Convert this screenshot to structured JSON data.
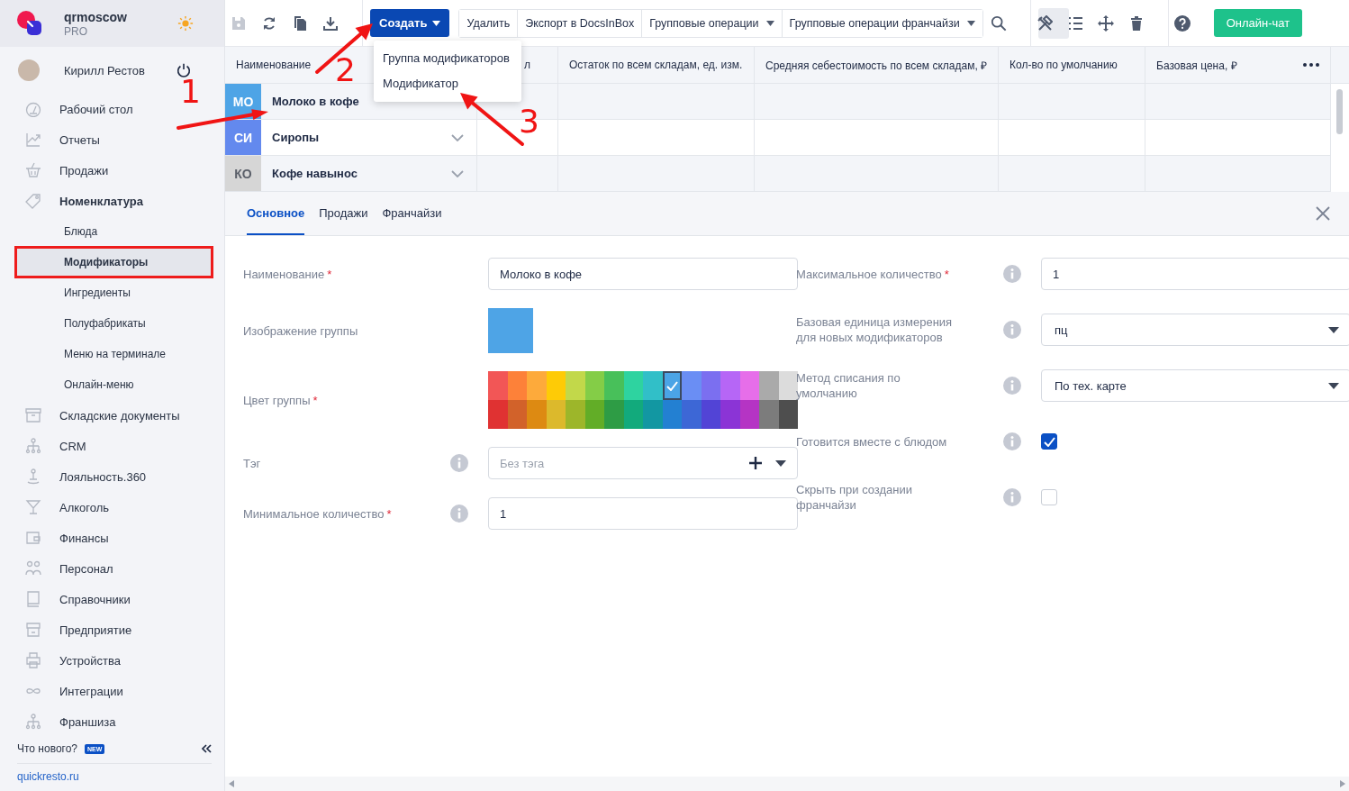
{
  "sidebar": {
    "account": {
      "name": "qrmoscow",
      "plan": "PRO"
    },
    "user": {
      "name": "Кирилл Рестов"
    },
    "nav": [
      {
        "label": "Рабочий стол",
        "expanded": false
      },
      {
        "label": "Отчеты",
        "expanded": false
      },
      {
        "label": "Продажи",
        "expanded": false
      },
      {
        "label": "Номенклатура",
        "expanded": true,
        "children": [
          {
            "label": "Блюда",
            "selected": false,
            "highlighted": false
          },
          {
            "label": "Модификаторы",
            "selected": true,
            "highlighted": true
          },
          {
            "label": "Ингредиенты",
            "selected": false,
            "highlighted": false
          },
          {
            "label": "Полуфабрикаты",
            "selected": false,
            "highlighted": false
          },
          {
            "label": "Меню на терминале",
            "selected": false,
            "highlighted": false
          },
          {
            "label": "Онлайн-меню",
            "selected": false,
            "highlighted": false
          }
        ]
      },
      {
        "label": "Складские документы",
        "expanded": false
      },
      {
        "label": "CRM",
        "expanded": false
      },
      {
        "label": "Лояльность.360",
        "expanded": false
      },
      {
        "label": "Алкоголь",
        "expanded": false
      },
      {
        "label": "Финансы",
        "expanded": false
      },
      {
        "label": "Персонал",
        "expanded": false
      },
      {
        "label": "Справочники",
        "expanded": false
      },
      {
        "label": "Предприятие",
        "expanded": false
      },
      {
        "label": "Устройства",
        "expanded": false
      },
      {
        "label": "Интеграции",
        "expanded": false
      },
      {
        "label": "Франшиза",
        "expanded": false
      }
    ],
    "whats_new": {
      "label": "Что нового?",
      "badge": "NEW"
    },
    "footer_link": "quickresto.ru"
  },
  "toolbar": {
    "create": {
      "label": "Создать",
      "open": true
    },
    "create_menu": [
      "Группа модификаторов",
      "Модификатор"
    ],
    "actions": [
      {
        "label": "Удалить",
        "dropdown": false
      },
      {
        "label": "Экспорт в DocsInBox",
        "dropdown": false
      },
      {
        "label": "Групповые операции",
        "dropdown": true
      },
      {
        "label": "Групповые операции франчайзи",
        "dropdown": true
      }
    ],
    "view_tools": [
      {
        "selected": true
      },
      {
        "selected": false
      },
      {
        "selected": false
      },
      {
        "selected": false
      }
    ],
    "chat_button": "Онлайн-чат"
  },
  "table": {
    "columns": [
      "Наименование",
      "л",
      "Остаток по всем складам, ед. изм.",
      "Средняя себестоимость по всем складам, ₽",
      "Кол-во по умолчанию",
      "Базовая цена, ₽"
    ],
    "rows": [
      {
        "tag": "МО",
        "color": "#4ea4e6",
        "name": "Молоко в кофе",
        "expandable": false
      },
      {
        "tag": "СИ",
        "color": "#6389ee",
        "name": "Сиропы",
        "expandable": true
      },
      {
        "tag": "КО",
        "color": "#d6d6d6",
        "name": "Кофе навынос",
        "expandable": true
      }
    ]
  },
  "detail": {
    "tabs": [
      {
        "label": "Основное",
        "selected": true
      },
      {
        "label": "Продажи",
        "selected": false
      },
      {
        "label": "Франчайзи",
        "selected": false
      }
    ],
    "left": [
      {
        "kind": "text",
        "label": "Наименование",
        "required_mark": "*",
        "info": false,
        "value": "Молоко в кофе"
      },
      {
        "kind": "image",
        "label": "Изображение группы",
        "info": false
      },
      {
        "kind": "palette",
        "label": "Цвет группы",
        "required_mark": "*",
        "info": false,
        "swatches": [
          [
            {
              "color": "#f25656",
              "selected": false
            },
            {
              "color": "#fd8139",
              "selected": false
            },
            {
              "color": "#fdaa3b",
              "selected": false
            },
            {
              "color": "#fecb06",
              "selected": false
            },
            {
              "color": "#c2d84a",
              "selected": false
            },
            {
              "color": "#84cd47",
              "selected": false
            },
            {
              "color": "#48c05a",
              "selected": false
            },
            {
              "color": "#2ed3a0",
              "selected": false
            },
            {
              "color": "#31bfc8",
              "selected": false
            },
            {
              "color": "#4ba4e6",
              "selected": true
            },
            {
              "color": "#6a8ef4",
              "selected": false
            },
            {
              "color": "#7b6ff0",
              "selected": false
            },
            {
              "color": "#b666f6",
              "selected": false
            },
            {
              "color": "#e66ee9",
              "selected": false
            },
            {
              "color": "#aaaaaa",
              "selected": false
            },
            {
              "color": "#dcdcdc",
              "selected": false
            }
          ],
          [
            {
              "color": "#e03232",
              "selected": false
            },
            {
              "color": "#d2622a",
              "selected": false
            },
            {
              "color": "#dd8a12",
              "selected": false
            },
            {
              "color": "#dcb92c",
              "selected": false
            },
            {
              "color": "#9db62a",
              "selected": false
            },
            {
              "color": "#62ad27",
              "selected": false
            },
            {
              "color": "#2e9c45",
              "selected": false
            },
            {
              "color": "#12aa7c",
              "selected": false
            },
            {
              "color": "#1297a2",
              "selected": false
            },
            {
              "color": "#2380d2",
              "selected": false
            },
            {
              "color": "#3d67d6",
              "selected": false
            },
            {
              "color": "#5244d6",
              "selected": false
            },
            {
              "color": "#8b34d6",
              "selected": false
            },
            {
              "color": "#b534c4",
              "selected": false
            },
            {
              "color": "#7c7c7c",
              "selected": false
            },
            {
              "color": "#4e4e4e",
              "selected": false
            }
          ]
        ]
      },
      {
        "kind": "tag",
        "label": "Тэг",
        "info": true,
        "placeholder": "Без тэга"
      },
      {
        "kind": "text",
        "label": "Минимальное количество",
        "required_mark": "*",
        "info": true,
        "value": "1"
      }
    ],
    "right": [
      {
        "kind": "text",
        "label": "Максимальное количество",
        "required_mark": "*",
        "info": true,
        "value": "1"
      },
      {
        "kind": "select",
        "label": "Базовая единица измерения для новых модификаторов",
        "info": true,
        "value": "пц"
      },
      {
        "kind": "select",
        "label": "Метод списания по умолчанию",
        "info": true,
        "value": "По тех. карте"
      },
      {
        "kind": "checkbox",
        "label": "Готовится вместе с блюдом",
        "info": true,
        "checked": true
      },
      {
        "kind": "checkbox",
        "label": "Скрыть при создании франчайзи",
        "info": true,
        "checked": false
      }
    ]
  },
  "annotations": [
    {
      "number": "1"
    },
    {
      "number": "2"
    },
    {
      "number": "3"
    }
  ]
}
